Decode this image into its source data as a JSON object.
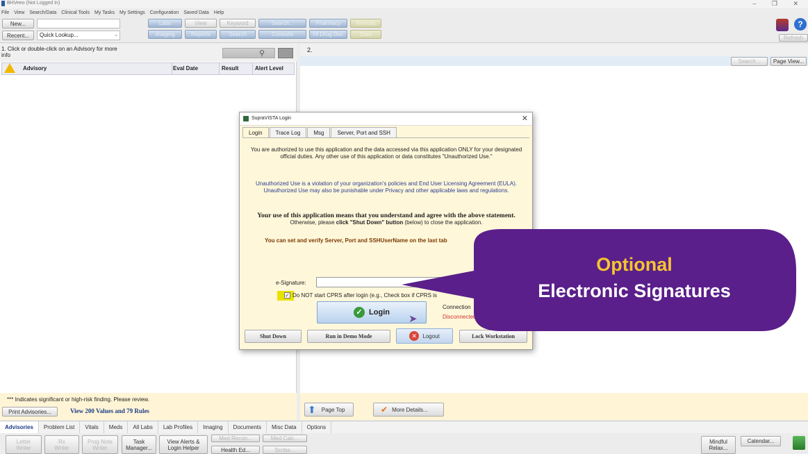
{
  "window": {
    "title": "BHVeeo (Not Logged In)",
    "controls": [
      "–",
      "❐",
      "✕"
    ]
  },
  "menu": [
    "File",
    "View",
    "Search/Data",
    "Clinical Tools",
    "My Tasks",
    "My Settings",
    "Configuration",
    "Saved Data",
    "Help"
  ],
  "toolbar": {
    "new_label": "New...",
    "recent_label": "Recent...",
    "quick_lookup": "Quick Lookup...",
    "labs": "Labs",
    "imaging": "Imaging",
    "view": "View",
    "reports": "Reports",
    "keyword": "Keyword",
    "search_dis": "Search",
    "search": "Search...",
    "consults": "Consults",
    "pharmacy": "Pharmacy",
    "drug_doc": "Hi Drug Doc",
    "remote": "Remote",
    "data": "Data",
    "refresh": "Refresh"
  },
  "left": {
    "hint": "1. Click or double-click on an Advisory for more info",
    "columns": [
      "Advisory",
      "Eval Date",
      "Result",
      "Alert Level"
    ],
    "legend": "*** Indicates significant or high-risk finding. Please review.",
    "print_btn": "Print Advisories...",
    "view_values": "View 200 Values and 79 Rules"
  },
  "right": {
    "number": "2.",
    "search_btn": "Search...",
    "page_view_btn": "Page View...",
    "page_top": "Page Top",
    "more_details": "More Details..."
  },
  "tabs": [
    "Advisories",
    "Problem List",
    "Vitals",
    "Meds",
    "All Labs",
    "Lab Profiles",
    "Imaging",
    "Documents",
    "Misc Data",
    "Options"
  ],
  "bottom": {
    "letter": "Letter",
    "writer": "Writer",
    "rx": "Rx",
    "rx_writer": "Writer",
    "prog_note": "Prog Note",
    "prog_writer": "Writer",
    "task_manager": "Task Manager...",
    "view_alerts": "View Alerts & Login Helper",
    "med_recon": "Med Recon...",
    "health_ed": "Health Ed...",
    "med_calc": "Med Calc...",
    "scribe": "Scribe...",
    "mindful": "Mindful Relax...",
    "calendar": "Calendar..."
  },
  "dialog": {
    "title": "SupraVISTA Login",
    "tabs": [
      "Login",
      "Trace Log",
      "Msg",
      "Server, Port and SSH"
    ],
    "para1": "You are authorized to use this application and the data accessed via this application ONLY for your designated official duties. Any other use of this application or data constitutes \"Unauthorized Use.\"",
    "para2": "Unauthorized Use is a violation of your organization's policies and End User Licensing Agreement (EULA). Unauthorized Use may also be punishable under Privacy and other applicable laws and regulations.",
    "para3_bold": "Your use of this application means that you understand and agree with the above statement.",
    "para3_rest": " Otherwise, please ",
    "para3_click": "click \"Shut Down\" button",
    "para3_end": " (below) to close the application.",
    "para4": "You can set and verify Server, Port and SSHUserName on the last tab",
    "esig_label": "e-Signature:",
    "checkbox_label": "Do NOT start CPRS after login (e.g., Check box if CPRS is",
    "login_btn": "Login",
    "connection": "Connection",
    "disconnected": "Disconnected",
    "shutdown_btn": "Shut Down",
    "demo_btn": "Run in Demo Mode",
    "logout_btn": "Logout",
    "lock_btn": "Lock Workstation"
  },
  "callout": {
    "line1": "Optional",
    "line2": "Electronic Signatures"
  },
  "colors": {
    "callout_purple": "#5a1f8a",
    "callout_gold": "#f5c431",
    "advisory_navy": "#1d3b86",
    "disconnected_red": "#cc3333"
  }
}
